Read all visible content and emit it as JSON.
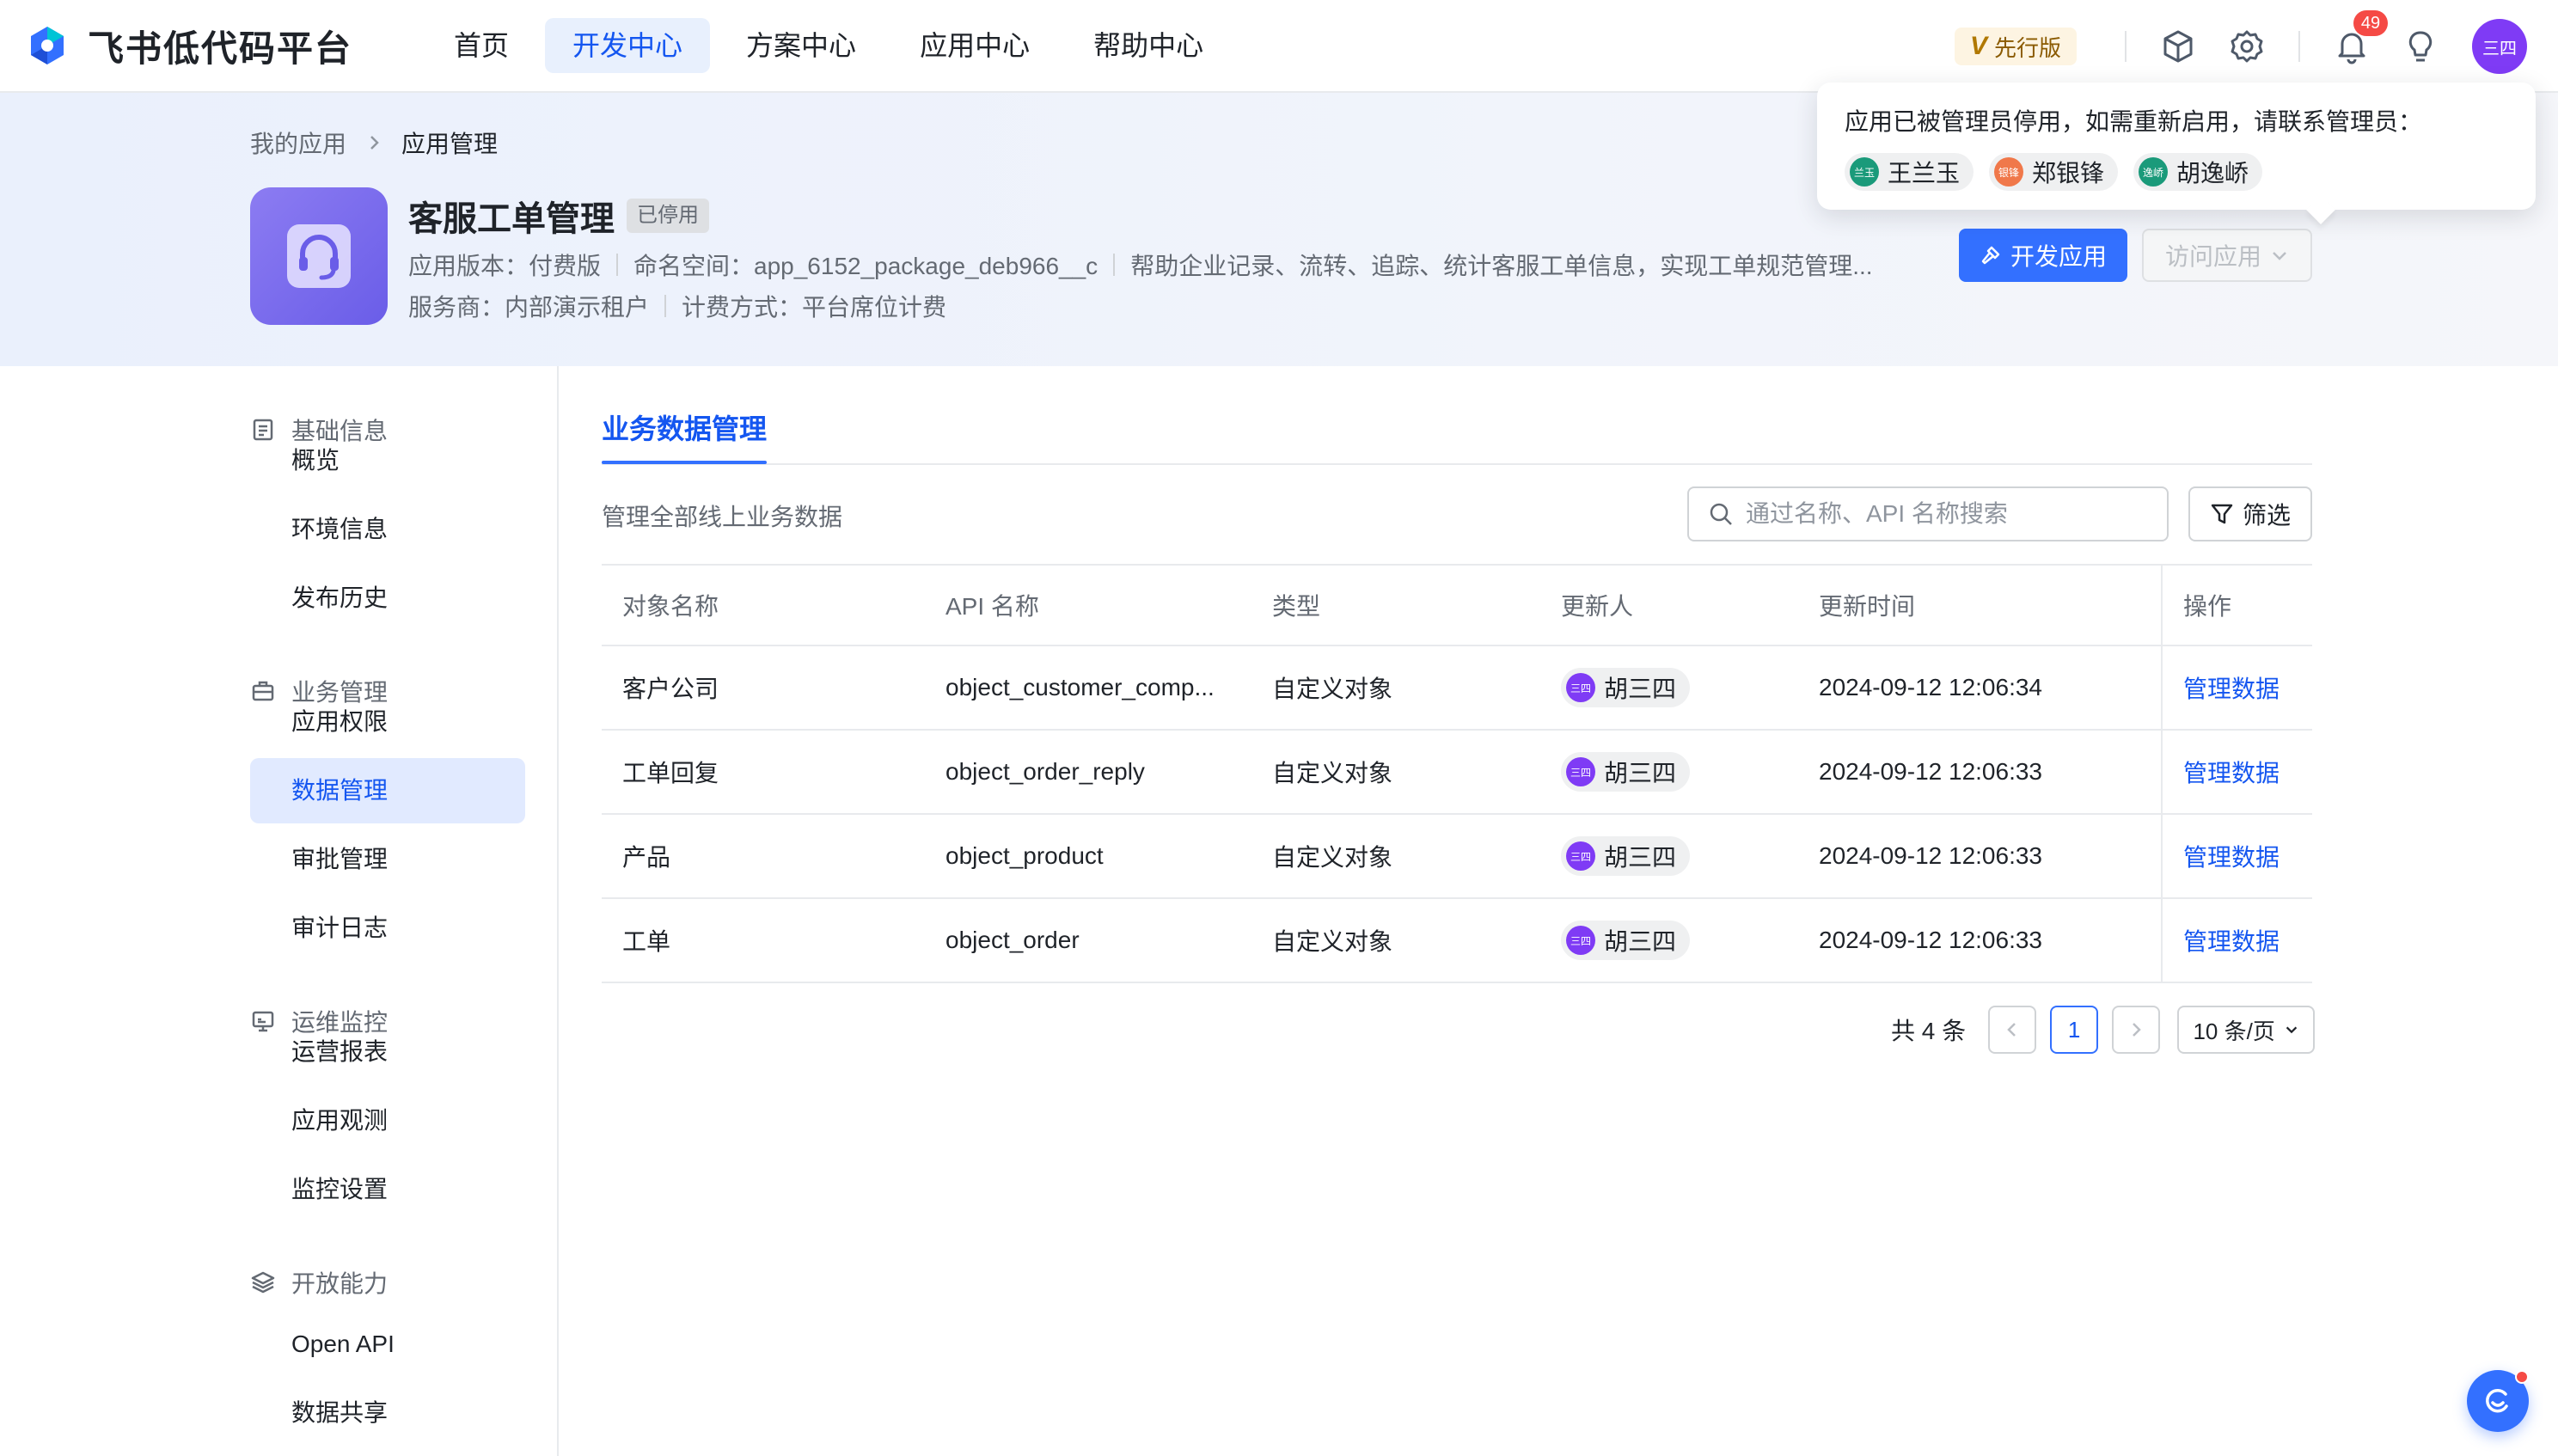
{
  "header": {
    "logo_text": "飞书低代码平台",
    "nav": [
      {
        "label": "首页"
      },
      {
        "label": "开发中心",
        "active": true
      },
      {
        "label": "方案中心"
      },
      {
        "label": "应用中心"
      },
      {
        "label": "帮助中心"
      }
    ],
    "version_badge_letter": "V",
    "version_badge_label": "先行版",
    "notification_count": "49",
    "avatar_text": "三四"
  },
  "breadcrumb": {
    "parent": "我的应用",
    "current": "应用管理"
  },
  "app": {
    "title": "客服工单管理",
    "status": "已停用",
    "version": "应用版本：付费版",
    "namespace": "命名空间：app_6152_package_deb966__c",
    "description": "帮助企业记录、流转、追踪、统计客服工单信息，实现工单规范管理...",
    "provider": "服务商：内部演示租户",
    "billing": "计费方式：平台席位计费",
    "develop_button": "开发应用",
    "visit_button": "访问应用"
  },
  "popover": {
    "text": "应用已被管理员停用，如需重新启用，请联系管理员：",
    "admins": [
      {
        "avatar": "兰玉",
        "name": "王兰玉",
        "color": "#1a9a7a"
      },
      {
        "avatar": "银锋",
        "name": "郑银锋",
        "color": "#f0784a"
      },
      {
        "avatar": "逸峤",
        "name": "胡逸峤",
        "color": "#1a9a7a"
      }
    ]
  },
  "sidebar": {
    "groups": [
      {
        "label": "基础信息",
        "icon": "document-icon",
        "items": [
          "概览",
          "环境信息",
          "发布历史"
        ]
      },
      {
        "label": "业务管理",
        "icon": "briefcase-icon",
        "items": [
          "应用权限",
          "数据管理",
          "审批管理",
          "审计日志"
        ]
      },
      {
        "label": "运维监控",
        "icon": "monitor-icon",
        "items": [
          "运营报表",
          "应用观测",
          "监控设置"
        ]
      },
      {
        "label": "开放能力",
        "icon": "layers-icon",
        "items": [
          "Open API",
          "数据共享"
        ]
      }
    ],
    "active_item": "数据管理"
  },
  "main": {
    "tab": "业务数据管理",
    "description": "管理全部线上业务数据",
    "search_placeholder": "通过名称、API 名称搜索",
    "filter_label": "筛选",
    "columns": [
      "对象名称",
      "API 名称",
      "类型",
      "更新人",
      "更新时间",
      "操作"
    ],
    "rows": [
      {
        "name": "客户公司",
        "api": "object_customer_comp...",
        "type": "自定义对象",
        "user_avatar": "三四",
        "user": "胡三四",
        "time": "2024-09-12 12:06:34",
        "action": "管理数据"
      },
      {
        "name": "工单回复",
        "api": "object_order_reply",
        "type": "自定义对象",
        "user_avatar": "三四",
        "user": "胡三四",
        "time": "2024-09-12 12:06:33",
        "action": "管理数据"
      },
      {
        "name": "产品",
        "api": "object_product",
        "type": "自定义对象",
        "user_avatar": "三四",
        "user": "胡三四",
        "time": "2024-09-12 12:06:33",
        "action": "管理数据"
      },
      {
        "name": "工单",
        "api": "object_order",
        "type": "自定义对象",
        "user_avatar": "三四",
        "user": "胡三四",
        "time": "2024-09-12 12:06:33",
        "action": "管理数据"
      }
    ],
    "pagination": {
      "total": "共 4 条",
      "current_page": "1",
      "page_size": "10 条/页"
    }
  },
  "colors": {
    "primary": "#3370ff",
    "link": "#1456f0",
    "avatar_purple": "#7f3bf5"
  }
}
